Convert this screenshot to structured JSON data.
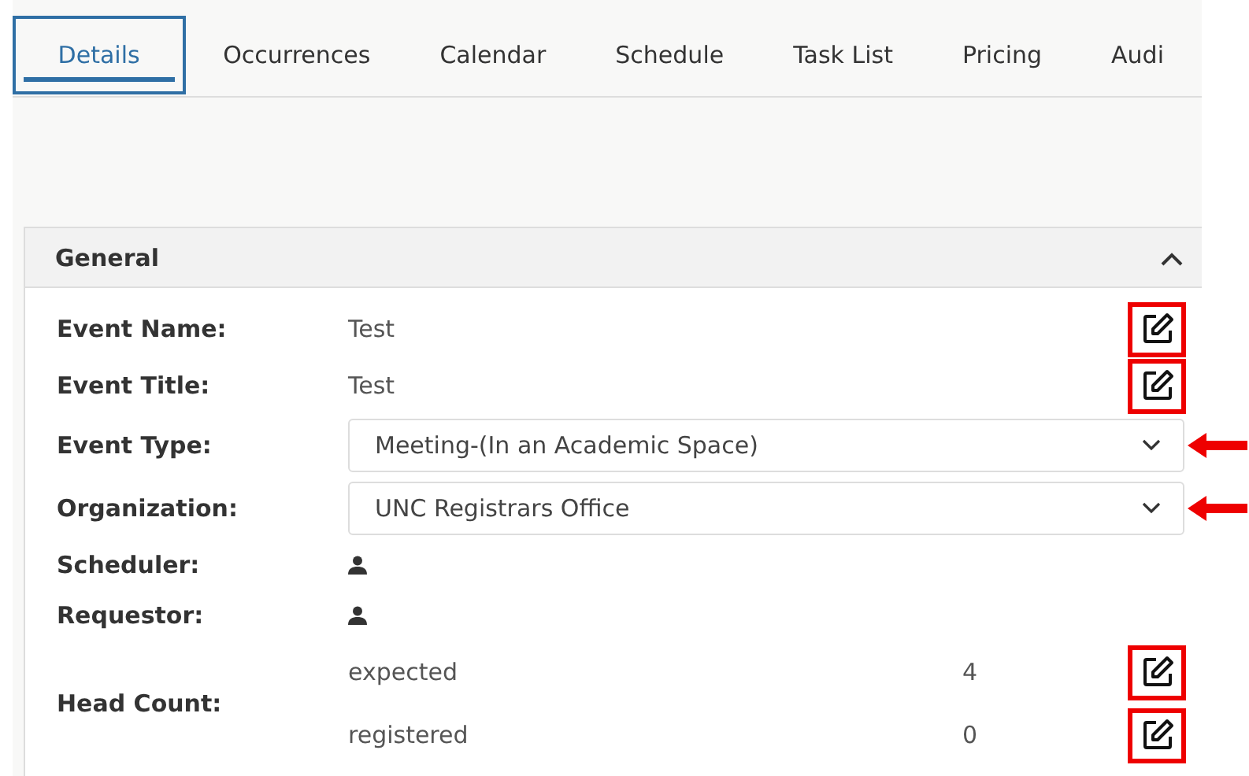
{
  "tabs": [
    {
      "label": "Details",
      "selected": true
    },
    {
      "label": "Occurrences",
      "selected": false
    },
    {
      "label": "Calendar",
      "selected": false
    },
    {
      "label": "Schedule",
      "selected": false
    },
    {
      "label": "Task List",
      "selected": false
    },
    {
      "label": "Pricing",
      "selected": false
    },
    {
      "label": "Audi",
      "selected": false
    }
  ],
  "panel": {
    "title": "General",
    "expanded": true,
    "fields": [
      {
        "kind": "text",
        "label": "Event Name:",
        "value": "Test",
        "edit_highlighted": true
      },
      {
        "kind": "text",
        "label": "Event Title:",
        "value": "Test",
        "edit_highlighted": true
      },
      {
        "kind": "select",
        "label": "Event Type:",
        "value": "Meeting-(In an Academic Space)",
        "arrow_marked": true
      },
      {
        "kind": "select",
        "label": "Organization:",
        "value": "UNC Registrars Office",
        "arrow_marked": true
      },
      {
        "kind": "person",
        "label": "Scheduler:"
      },
      {
        "kind": "person",
        "label": "Requestor:"
      },
      {
        "kind": "counts",
        "label": "Head Count:",
        "rows": [
          {
            "name": "expected",
            "count": "4",
            "edit_highlighted": true
          },
          {
            "name": "registered",
            "count": "0",
            "edit_highlighted": true
          }
        ]
      }
    ]
  }
}
